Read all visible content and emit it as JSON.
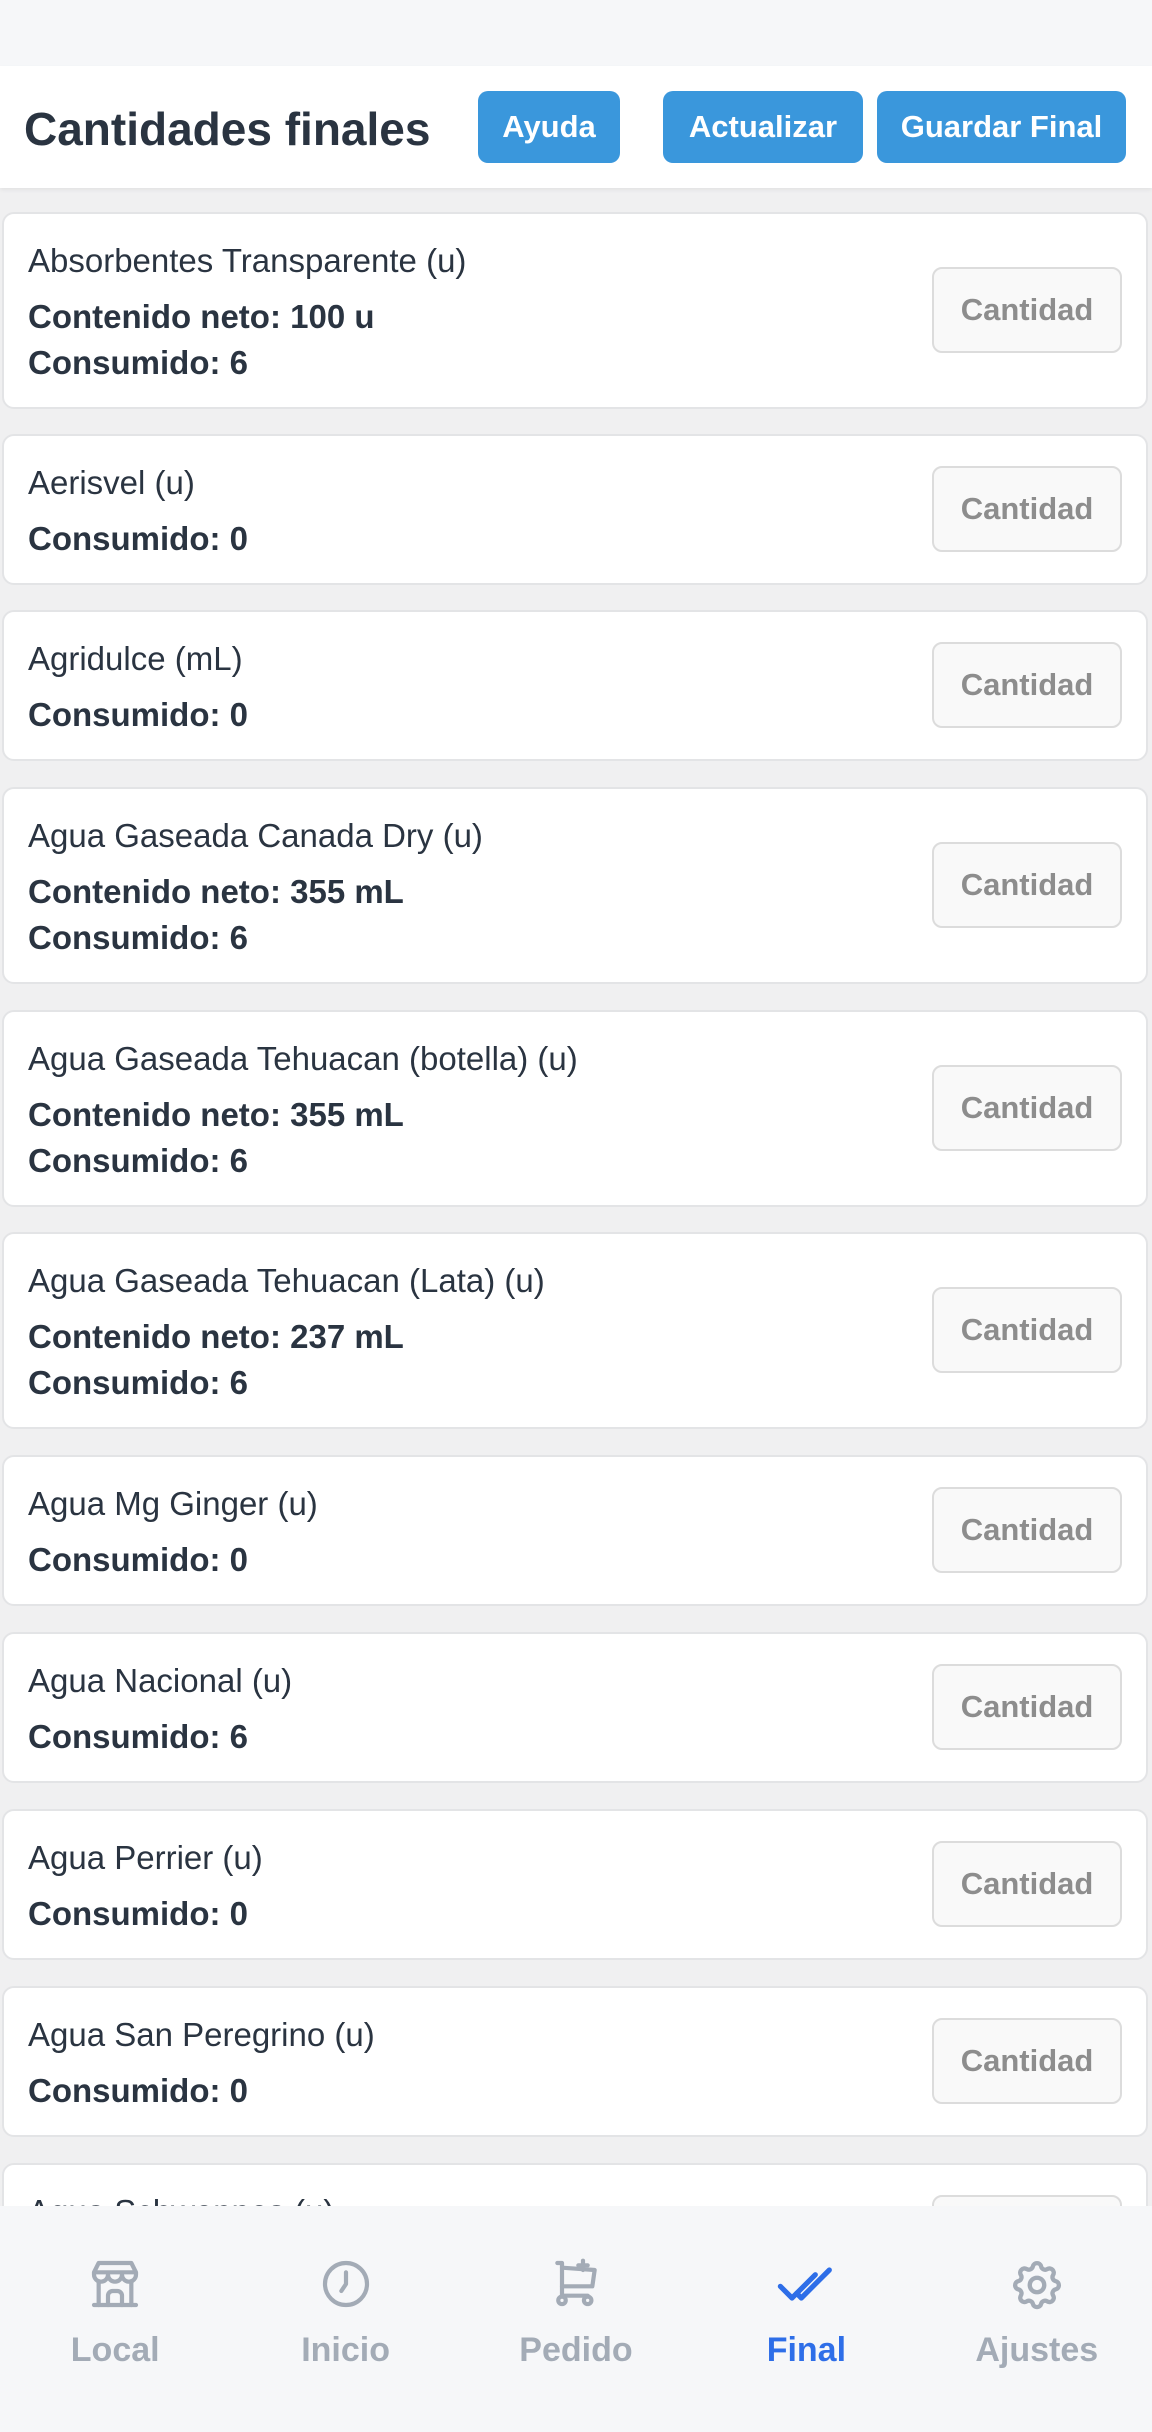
{
  "header": {
    "title": "Cantidades finales",
    "help_label": "Ayuda",
    "refresh_label": "Actualizar",
    "save_label": "Guardar Final"
  },
  "quantity_placeholder": "Cantidad",
  "items": [
    {
      "name": "Absorbentes Transparente (u)",
      "net": "Contenido neto: 100 u",
      "consumed": "Consumido: 6"
    },
    {
      "name": "Aerisvel (u)",
      "consumed": "Consumido: 0"
    },
    {
      "name": "Agridulce (mL)",
      "consumed": "Consumido: 0"
    },
    {
      "name": "Agua Gaseada Canada Dry (u)",
      "net": "Contenido neto: 355 mL",
      "consumed": "Consumido: 6"
    },
    {
      "name": "Agua Gaseada Tehuacan (botella) (u)",
      "net": "Contenido neto: 355 mL",
      "consumed": "Consumido: 6"
    },
    {
      "name": "Agua Gaseada Tehuacan (Lata) (u)",
      "net": "Contenido neto: 237 mL",
      "consumed": "Consumido: 6"
    },
    {
      "name": "Agua Mg Ginger (u)",
      "consumed": "Consumido: 0"
    },
    {
      "name": "Agua Nacional (u)",
      "consumed": "Consumido: 6"
    },
    {
      "name": "Agua Perrier (u)",
      "consumed": "Consumido: 0"
    },
    {
      "name": "Agua San Peregrino (u)",
      "consumed": "Consumido: 0"
    },
    {
      "name": "Agua Schweppes (u)"
    }
  ],
  "tabs": [
    {
      "label": "Local",
      "icon": "store-icon",
      "active": false
    },
    {
      "label": "Inicio",
      "icon": "clock-icon",
      "active": false
    },
    {
      "label": "Pedido",
      "icon": "cart-add-icon",
      "active": false
    },
    {
      "label": "Final",
      "icon": "double-check-icon",
      "active": true
    },
    {
      "label": "Ajustes",
      "icon": "gear-icon",
      "active": false
    }
  ],
  "colors": {
    "accent_button": "#3a97dc",
    "active_tab": "#2e6ee8",
    "inactive_tab": "#a3abb6"
  }
}
